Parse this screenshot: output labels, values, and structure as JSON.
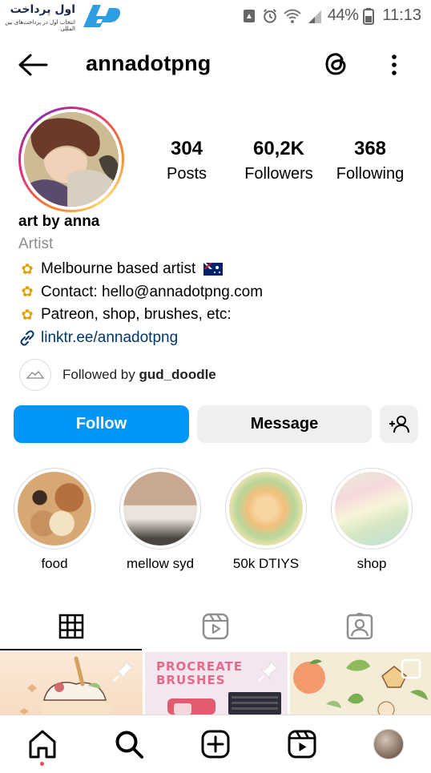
{
  "status_bar": {
    "brand_title": "اول پرداخت",
    "brand_sub": "انتخاب اول در پرداخت‌های بین المللی",
    "battery_pct": "44%",
    "time": "11:13"
  },
  "header": {
    "username": "annadotpng"
  },
  "profile": {
    "stats": [
      {
        "num": "304",
        "label": "Posts"
      },
      {
        "num": "60,2K",
        "label": "Followers"
      },
      {
        "num": "368",
        "label": "Following"
      }
    ],
    "name": "art by anna",
    "category": "Artist",
    "bio_lines": [
      "Melbourne based artist",
      "Contact: hello@annadotpng.com",
      "Patreon, shop, brushes, etc:"
    ],
    "link": "linktr.ee/annadotpng",
    "followed_by_prefix": "Followed by ",
    "followed_by_user": "gud_doodle"
  },
  "actions": {
    "follow": "Follow",
    "message": "Message"
  },
  "highlights": [
    {
      "label": "food"
    },
    {
      "label": "mellow syd"
    },
    {
      "label": "50k DTIYS"
    },
    {
      "label": "shop"
    }
  ],
  "grid": {
    "cell2_title_line1": "PROCREATE",
    "cell2_title_line2": "BRUSHES"
  },
  "colors": {
    "accent": "#0095f6",
    "link": "#00376b",
    "secondary_text": "#8e8e8e",
    "button_gray": "#efefef",
    "notification_dot": "#ed4956"
  }
}
